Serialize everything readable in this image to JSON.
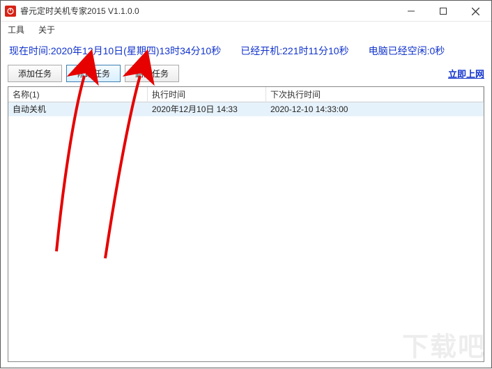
{
  "window": {
    "title": "睿元定时关机专家2015 V1.1.0.0"
  },
  "menu": {
    "tools": "工具",
    "about": "关于"
  },
  "status": {
    "now": "现在时间:2020年12月10日(星期四)13时34分10秒",
    "uptime": "已经开机:221时11分10秒",
    "idle": "电脑已经空闲:0秒"
  },
  "toolbar": {
    "add": "添加任务",
    "edit": "修改任务",
    "del": "删除任务",
    "link": "立即上网"
  },
  "grid": {
    "headers": {
      "name": "名称(1)",
      "exec": "执行时间",
      "next": "下次执行时间"
    },
    "row": {
      "name": "自动关机",
      "exec": "2020年12月10日 14:33",
      "next": "2020-12-10 14:33:00"
    }
  },
  "watermark": "下载吧"
}
